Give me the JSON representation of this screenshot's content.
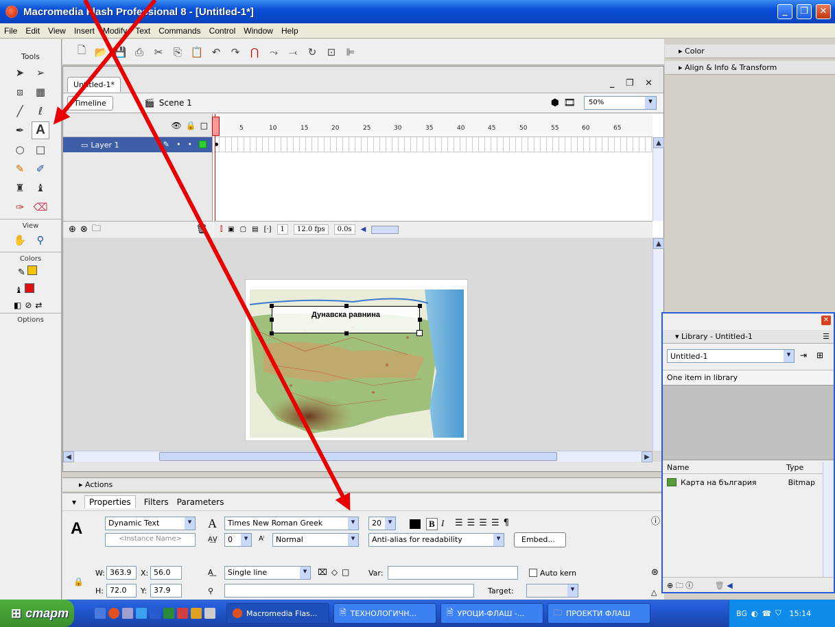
{
  "window": {
    "title": "Macromedia Flash Professional 8 - [Untitled-1*]"
  },
  "menu": [
    "File",
    "Edit",
    "View",
    "Insert",
    "Modify",
    "Text",
    "Commands",
    "Control",
    "Window",
    "Help"
  ],
  "tools": {
    "header": "Tools",
    "sections": {
      "view": "View",
      "colors": "Colors",
      "options": "Options"
    },
    "text_tool_glyph": "A",
    "stroke_color": "#f5c400",
    "fill_color": "#e01010"
  },
  "document": {
    "tab": "Untitled-1*",
    "timeline_button": "Timeline",
    "scene": "Scene 1",
    "zoom": "50%"
  },
  "timeline": {
    "layer_name": "Layer 1",
    "ruler_ticks": [
      "1",
      "5",
      "10",
      "15",
      "20",
      "25",
      "30",
      "35",
      "40",
      "45",
      "50",
      "55",
      "60",
      "65"
    ],
    "current_frame": "1",
    "fps": "12.0 fps",
    "time": "0.0s"
  },
  "stage": {
    "textbox_text": "Дунавска равнина"
  },
  "panels": {
    "actions": "Actions",
    "tabs": [
      "Properties",
      "Filters",
      "Parameters"
    ],
    "text_type": "Dynamic Text",
    "instance_placeholder": "<Instance Name>",
    "font": "Times New Roman Greek",
    "font_size": "20",
    "letter_spacing": "0",
    "baseline": "Normal",
    "antialias": "Anti-alias for readability",
    "embed": "Embed...",
    "w_label": "W:",
    "w": "363.9",
    "x_label": "X:",
    "x": "56.0",
    "h_label": "H:",
    "h": "72.0",
    "y_label": "Y:",
    "y": "37.9",
    "line_type": "Single line",
    "var_label": "Var:",
    "auto_kern": "Auto kern",
    "target_label": "Target:",
    "bold": "B",
    "italic": "I"
  },
  "right": {
    "color": "Color",
    "align": "Align & Info & Transform"
  },
  "library": {
    "title": "Library - Untitled-1",
    "selected": "Untitled-1",
    "count": "One item in library",
    "col_name": "Name",
    "col_type": "Type",
    "item_name": "Карта на българия",
    "item_type": "Bitmap"
  },
  "taskbar": {
    "start": "старт",
    "tasks": [
      "Macromedia Flas...",
      "ТЕХНОЛОГИЧН...",
      "УРОЦИ-ФЛАШ -...",
      "ПРОЕКТИ ФЛАШ"
    ],
    "lang": "BG",
    "clock": "15:14"
  }
}
